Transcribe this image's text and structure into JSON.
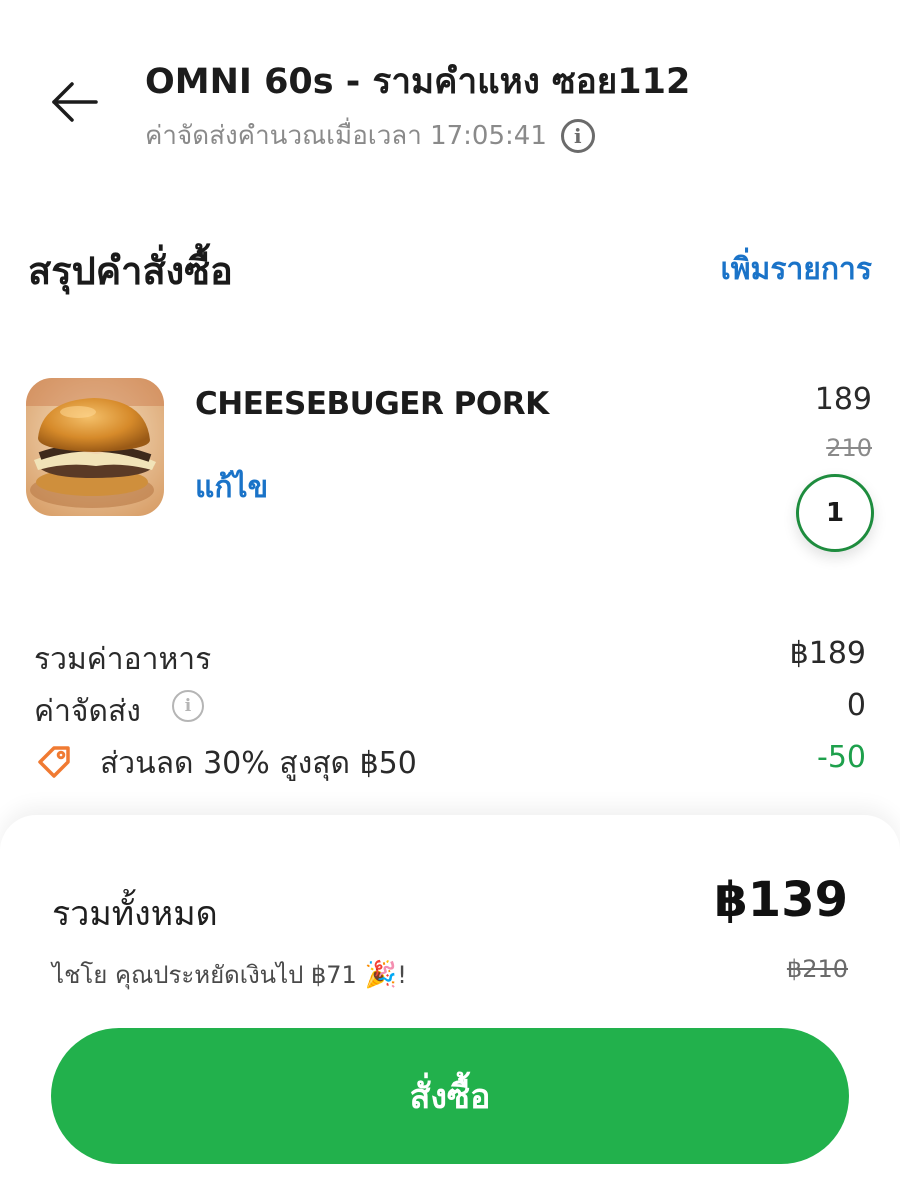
{
  "header": {
    "store_name": "OMNI 60s - รามคำแหง ซอย112",
    "delivery_fee_note": "ค่าจัดส่งคำนวณเมื่อเวลา 17:05:41",
    "back_icon": "arrow-left-icon",
    "info_icon": "info-icon"
  },
  "summary": {
    "title": "สรุปคำสั่งซื้อ",
    "add_items_label": "เพิ่มรายการ"
  },
  "items": [
    {
      "name": "CHEESEBUGER PORK",
      "edit_label": "แก้ไข",
      "price": "189",
      "original_price": "210",
      "quantity": "1",
      "image": "cheeseburger-photo"
    }
  ],
  "breakdown": {
    "food_total_label": "รวมค่าอาหาร",
    "food_total_value": "฿189",
    "delivery_label": "ค่าจัดส่ง",
    "delivery_value": "0",
    "discount_label": "ส่วนลด 30% สูงสุด ฿50",
    "discount_value": "-50",
    "discount_icon": "tag-icon"
  },
  "footer": {
    "total_label": "รวมทั้งหมด",
    "total_value": "฿139",
    "savings_text": "ไชโย คุณประหยัดเงินไป  ฿71",
    "savings_emoji": "🎉",
    "savings_suffix": "!",
    "original_total": "฿210",
    "order_button_label": "สั่งซื้อ"
  },
  "colors": {
    "accent_blue": "#1a73c8",
    "primary_green": "#22b14c",
    "discount_green": "#1ea04c",
    "tag_orange": "#f07a32"
  }
}
